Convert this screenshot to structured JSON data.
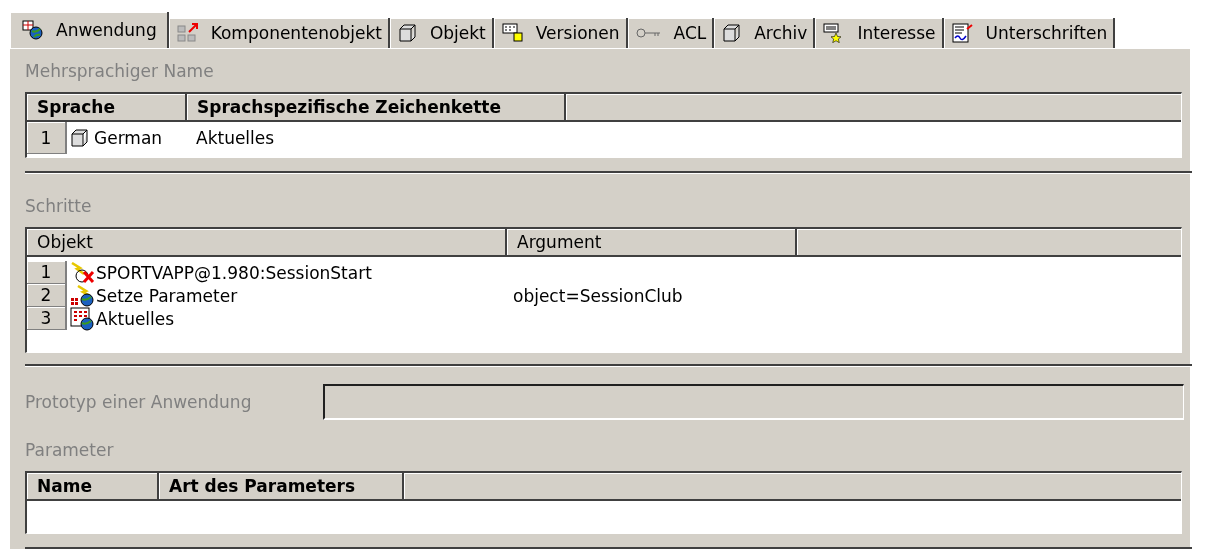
{
  "tabs": [
    {
      "label": "Anwendung",
      "selected": true
    },
    {
      "label": "Komponentenobjekt",
      "selected": false
    },
    {
      "label": "Objekt",
      "selected": false
    },
    {
      "label": "Versionen",
      "selected": false
    },
    {
      "label": "ACL",
      "selected": false
    },
    {
      "label": "Archiv",
      "selected": false
    },
    {
      "label": "Interesse",
      "selected": false
    },
    {
      "label": "Unterschriften",
      "selected": false
    }
  ],
  "name_section": {
    "label": "Mehrsprachiger Name",
    "table": {
      "columns": [
        "Sprache",
        "Sprachspezifische Zeichenkette"
      ],
      "rows": [
        {
          "number": "1",
          "language": "German",
          "text": "Aktuelles"
        }
      ]
    }
  },
  "steps_section": {
    "label": "Schritte",
    "table": {
      "columns": [
        "Objekt",
        "Argument"
      ],
      "rows": [
        {
          "number": "1",
          "kind": "start",
          "object": "SPORTVAPP@1.980:SessionStart"
        },
        {
          "number": "2",
          "kind": "action",
          "object": "Setze Parameter",
          "argument": "object=SessionClub"
        },
        {
          "number": "3",
          "kind": "page",
          "object": "Aktuelles"
        }
      ]
    }
  },
  "prototype_field": {
    "label": "Prototyp einer Anwendung"
  },
  "parameter_section": {
    "label": "Parameter",
    "table": {
      "columns": [
        "Name",
        "Art des Parameters"
      ]
    }
  }
}
